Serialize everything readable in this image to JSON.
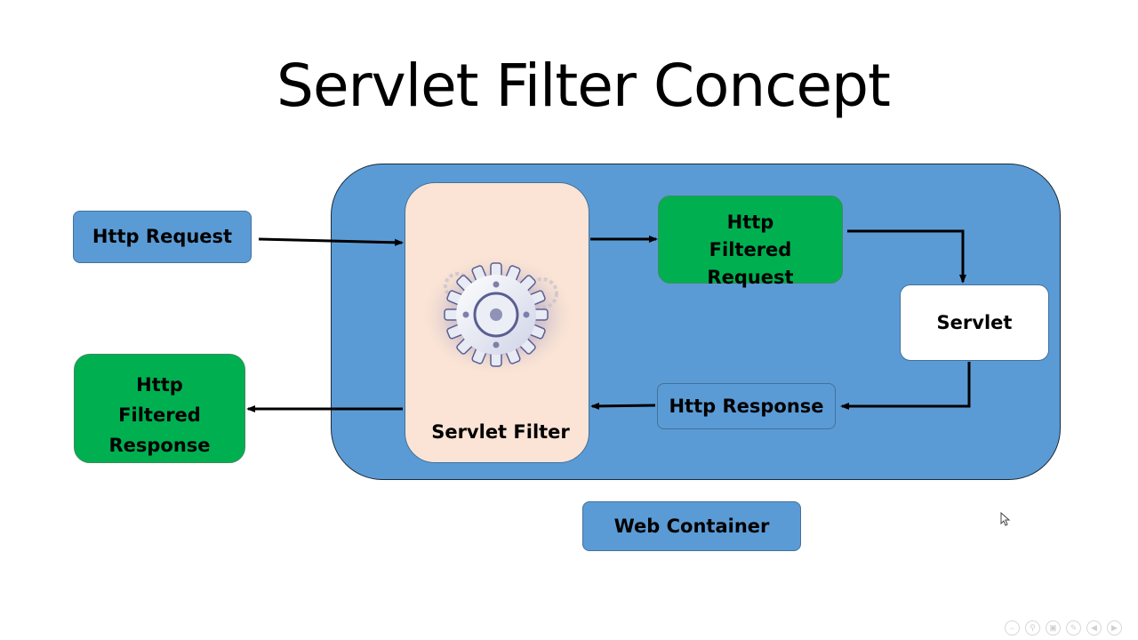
{
  "slide": {
    "title": "Servlet Filter Concept"
  },
  "diagram": {
    "nodes": {
      "http_request": "Http Request",
      "http_filtered_response": "Http Filtered Response",
      "servlet_filter": "Servlet Filter",
      "http_filtered_request": "Http Filtered Request",
      "servlet": "Servlet",
      "http_response": "Http Response",
      "web_container": "Web Container"
    },
    "colors": {
      "container_blue": "#5b9bd5",
      "filtered_green": "#00b050",
      "filter_peach": "#fbe4d5",
      "servlet_white": "#ffffff"
    },
    "edges": [
      {
        "from": "Http Request",
        "to": "Servlet Filter"
      },
      {
        "from": "Servlet Filter",
        "to": "Http Filtered Request"
      },
      {
        "from": "Http Filtered Request",
        "to": "Servlet"
      },
      {
        "from": "Servlet",
        "to": "Http Response"
      },
      {
        "from": "Http Response",
        "to": "Servlet Filter"
      },
      {
        "from": "Servlet Filter",
        "to": "Http Filtered Response"
      }
    ]
  },
  "presenter_controls": {
    "icons": [
      "zoom-out-icon",
      "search-icon",
      "slides-icon",
      "pen-icon",
      "previous-icon",
      "next-icon"
    ]
  }
}
